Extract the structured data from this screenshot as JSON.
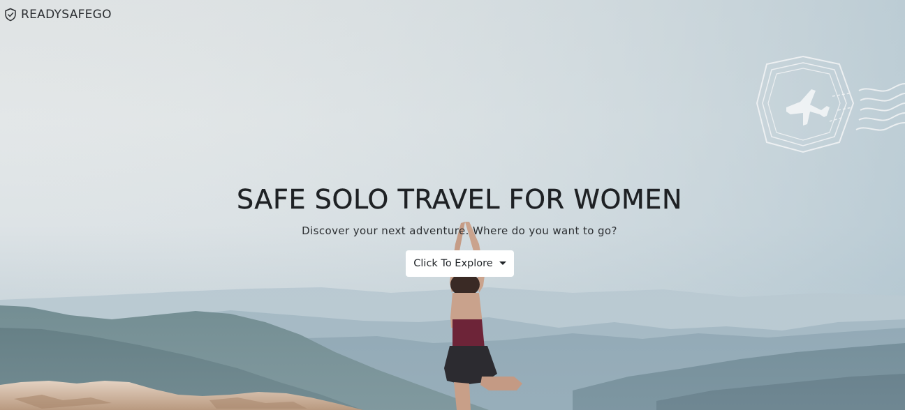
{
  "brand": {
    "name": "READYSAFEGO",
    "icon": "shield-check-icon"
  },
  "hero": {
    "headline": "SAFE SOLO TRAVEL FOR WOMEN",
    "subline": "Discover your next adventure. Where do you want to go?",
    "explore_button": "Click To Explore",
    "explore_icon": "caret-down-icon",
    "decor_icon": "airplane-stamp-icon"
  },
  "colors": {
    "text": "#1e2124",
    "button_bg": "#ffffff",
    "sky": "#e3e7e8",
    "mountains": "#6f8897"
  }
}
